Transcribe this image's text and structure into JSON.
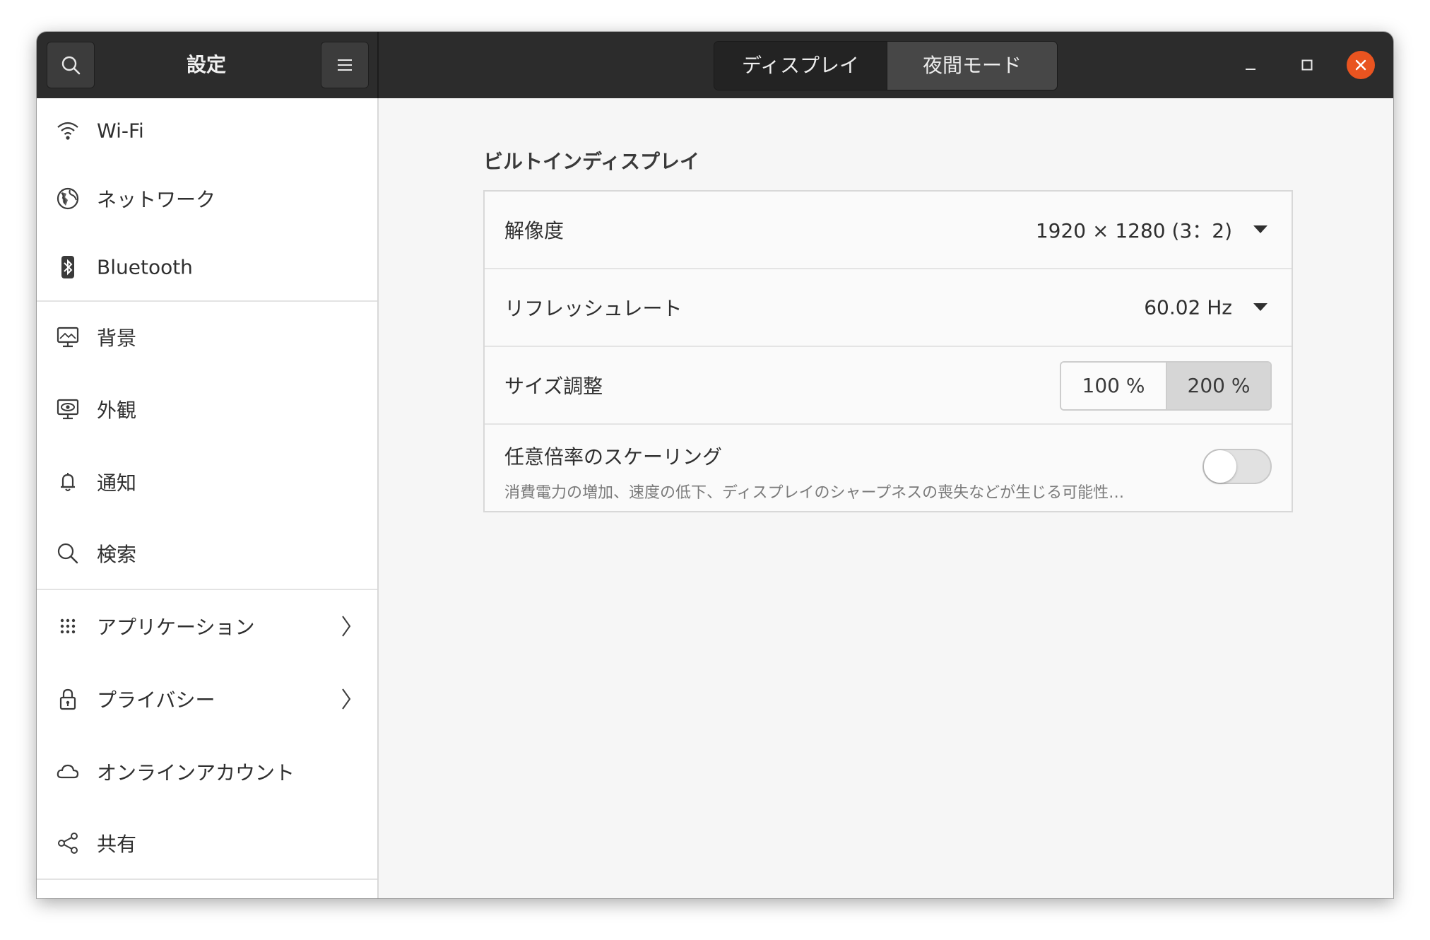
{
  "header": {
    "search_icon": "search-icon",
    "title": "設定",
    "menu_icon": "hamburger-menu-icon",
    "tabs": [
      {
        "label": "ディスプレイ",
        "active": true
      },
      {
        "label": "夜間モード",
        "active": false
      }
    ],
    "window_controls": [
      "minimize-icon",
      "maximize-icon",
      "close-icon"
    ],
    "close_color": "#e95420"
  },
  "sidebar": {
    "items": [
      {
        "label": "Wi-Fi",
        "icon": "wifi-icon"
      },
      {
        "label": "ネットワーク",
        "icon": "globe-icon"
      },
      {
        "label": "Bluetooth",
        "icon": "bluetooth-icon"
      },
      {
        "label": "背景",
        "icon": "monitor-icon"
      },
      {
        "label": "外観",
        "icon": "appearance-icon"
      },
      {
        "label": "通知",
        "icon": "bell-icon"
      },
      {
        "label": "検索",
        "icon": "search-icon"
      },
      {
        "label": "アプリケーション",
        "icon": "apps-grid-icon",
        "has_submenu": true
      },
      {
        "label": "プライバシー",
        "icon": "lock-icon",
        "has_submenu": true
      },
      {
        "label": "オンラインアカウント",
        "icon": "cloud-icon"
      },
      {
        "label": "共有",
        "icon": "share-icon"
      }
    ]
  },
  "main": {
    "section_title": "ビルトインディスプレイ",
    "resolution": {
      "label": "解像度",
      "value": "1920 × 1280 (3：2)"
    },
    "refresh_rate": {
      "label": "リフレッシュレート",
      "value": "60.02 Hz"
    },
    "scale": {
      "label": "サイズ調整",
      "options": [
        "100 %",
        "200 %"
      ],
      "selected": "200 %"
    },
    "fractional_scaling": {
      "label": "任意倍率のスケーリング",
      "description": "消費電力の増加、速度の低下、ディスプレイのシャープネスの喪失などが生じる可能性…",
      "enabled": false
    }
  }
}
